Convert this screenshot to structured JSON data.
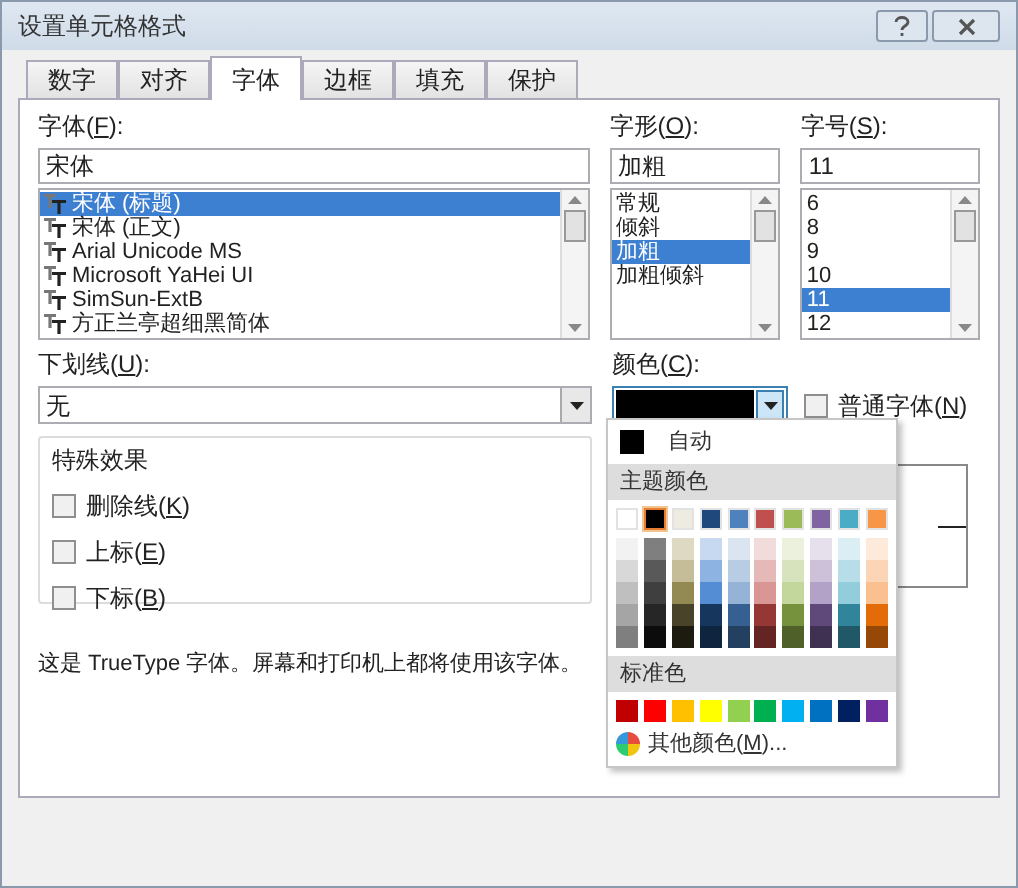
{
  "window": {
    "title": "设置单元格格式"
  },
  "tabs": [
    {
      "label": "数字",
      "selected": false
    },
    {
      "label": "对齐",
      "selected": false
    },
    {
      "label": "字体",
      "selected": true
    },
    {
      "label": "边框",
      "selected": false
    },
    {
      "label": "填充",
      "selected": false
    },
    {
      "label": "保护",
      "selected": false
    }
  ],
  "font": {
    "label": [
      "字体(",
      "F",
      "):"
    ],
    "value": "宋体",
    "items": [
      {
        "label": "宋体 (标题)",
        "selected": true
      },
      {
        "label": "宋体 (正文)",
        "selected": false
      },
      {
        "label": "Arial Unicode MS",
        "selected": false
      },
      {
        "label": "Microsoft YaHei UI",
        "selected": false
      },
      {
        "label": "SimSun-ExtB",
        "selected": false
      },
      {
        "label": "方正兰亭超细黑简体",
        "selected": false
      }
    ]
  },
  "style": {
    "label": [
      "字形(",
      "O",
      "):"
    ],
    "value": "加粗",
    "items": [
      {
        "label": "常规",
        "selected": false
      },
      {
        "label": "倾斜",
        "selected": false
      },
      {
        "label": "加粗",
        "selected": true
      },
      {
        "label": "加粗倾斜",
        "selected": false
      }
    ]
  },
  "size": {
    "label": [
      "字号(",
      "S",
      "):"
    ],
    "value": "11",
    "items": [
      {
        "label": "6",
        "selected": false
      },
      {
        "label": "8",
        "selected": false
      },
      {
        "label": "9",
        "selected": false
      },
      {
        "label": "10",
        "selected": false
      },
      {
        "label": "11",
        "selected": true
      },
      {
        "label": "12",
        "selected": false
      }
    ]
  },
  "underline": {
    "label": [
      "下划线(",
      "U",
      "):"
    ],
    "value": "无"
  },
  "color": {
    "label": [
      "颜色(",
      "C",
      "):"
    ],
    "color": "#000000"
  },
  "normal_font": {
    "label": [
      "普通字体(",
      "N",
      ")"
    ],
    "checked": false
  },
  "effects": {
    "title": "特殊效果",
    "items": [
      {
        "label": [
          "删除线(",
          "K",
          ")"
        ],
        "checked": false
      },
      {
        "label": [
          "上标(",
          "E",
          ")"
        ],
        "checked": false
      },
      {
        "label": [
          "下标(",
          "B",
          ")"
        ],
        "checked": false
      }
    ]
  },
  "info": "这是 TrueType 字体。屏幕和打印机上都将使用该字体。",
  "color_menu": {
    "automatic": {
      "label": "自动",
      "color": "#000000"
    },
    "theme_title": "主题颜色",
    "theme": [
      {
        "color": "#ffffff",
        "selected": false,
        "shades": [
          {
            "color": "#f2f2f2"
          },
          {
            "color": "#d8d8d8"
          },
          {
            "color": "#bfbfbf"
          },
          {
            "color": "#a5a5a5"
          },
          {
            "color": "#7f7f7f"
          }
        ]
      },
      {
        "color": "#000000",
        "selected": true,
        "shades": [
          {
            "color": "#7f7f7f"
          },
          {
            "color": "#595959"
          },
          {
            "color": "#3f3f3f"
          },
          {
            "color": "#262626"
          },
          {
            "color": "#0c0c0c"
          }
        ]
      },
      {
        "color": "#eeece1",
        "selected": false,
        "shades": [
          {
            "color": "#ddd9c3"
          },
          {
            "color": "#c4bd97"
          },
          {
            "color": "#938953"
          },
          {
            "color": "#494429"
          },
          {
            "color": "#1d1b10"
          }
        ]
      },
      {
        "color": "#1f497d",
        "selected": false,
        "shades": [
          {
            "color": "#c6d9f0"
          },
          {
            "color": "#8db3e2"
          },
          {
            "color": "#548dd4"
          },
          {
            "color": "#17365d"
          },
          {
            "color": "#0f243e"
          }
        ]
      },
      {
        "color": "#4f81bd",
        "selected": false,
        "shades": [
          {
            "color": "#dbe5f1"
          },
          {
            "color": "#b8cce4"
          },
          {
            "color": "#95b3d7"
          },
          {
            "color": "#366092"
          },
          {
            "color": "#244061"
          }
        ]
      },
      {
        "color": "#c0504d",
        "selected": false,
        "shades": [
          {
            "color": "#f2dcdb"
          },
          {
            "color": "#e5b9b7"
          },
          {
            "color": "#d99694"
          },
          {
            "color": "#953734"
          },
          {
            "color": "#632423"
          }
        ]
      },
      {
        "color": "#9bbb59",
        "selected": false,
        "shades": [
          {
            "color": "#ebf1dd"
          },
          {
            "color": "#d7e3bc"
          },
          {
            "color": "#c3d69b"
          },
          {
            "color": "#76923c"
          },
          {
            "color": "#4f6128"
          }
        ]
      },
      {
        "color": "#8064a2",
        "selected": false,
        "shades": [
          {
            "color": "#e5e0ec"
          },
          {
            "color": "#ccc1d9"
          },
          {
            "color": "#b2a2c7"
          },
          {
            "color": "#5f497a"
          },
          {
            "color": "#3f3151"
          }
        ]
      },
      {
        "color": "#4bacc6",
        "selected": false,
        "shades": [
          {
            "color": "#dbeef3"
          },
          {
            "color": "#b7dde8"
          },
          {
            "color": "#92cddc"
          },
          {
            "color": "#31859b"
          },
          {
            "color": "#205867"
          }
        ]
      },
      {
        "color": "#f79646",
        "selected": false,
        "shades": [
          {
            "color": "#fdeada"
          },
          {
            "color": "#fbd5b5"
          },
          {
            "color": "#fac08f"
          },
          {
            "color": "#e36c09"
          },
          {
            "color": "#974806"
          }
        ]
      }
    ],
    "standard_title": "标准色",
    "standard": [
      {
        "color": "#c00000",
        "selected": false
      },
      {
        "color": "#ff0000",
        "selected": false
      },
      {
        "color": "#ffc000",
        "selected": false
      },
      {
        "color": "#ffff00",
        "selected": false
      },
      {
        "color": "#92d050",
        "selected": false
      },
      {
        "color": "#00b050",
        "selected": false
      },
      {
        "color": "#00b0f0",
        "selected": false
      },
      {
        "color": "#0070c0",
        "selected": false
      },
      {
        "color": "#002060",
        "selected": false
      },
      {
        "color": "#7030a0",
        "selected": false
      }
    ],
    "more": [
      "其他颜色(",
      "M",
      ")..."
    ]
  }
}
